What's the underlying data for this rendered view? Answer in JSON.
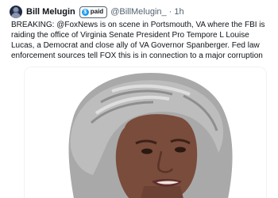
{
  "tweet": {
    "author": {
      "name": "Bill Melugin",
      "badge_label": "paid",
      "badge_icon": "dollar-icon",
      "badge_icon_glyph": "$",
      "handle": "@BillMelugin_",
      "separator": "·",
      "time": "1h"
    },
    "text": "BREAKING: @FoxNews is on scene in Portsmouth, VA where the FBI is raiding the office of Virginia Senate President Pro Tempore L Louise Lucas, a Democrat and close ally of VA Governor Spanberger. Fed law enforcement sources tell FOX this is in connection to a major corruption",
    "media": {
      "kind": "photo",
      "colors": {
        "hair": "#b7b7b7",
        "hair_shadow": "#8e8e8e",
        "skin": "#7a4c3b",
        "lips": "#5f2d2f",
        "background": "#ffffff"
      }
    }
  },
  "colors": {
    "text_primary": "#0f1419",
    "text_secondary": "#536471",
    "accent": "#1d9bf0"
  }
}
